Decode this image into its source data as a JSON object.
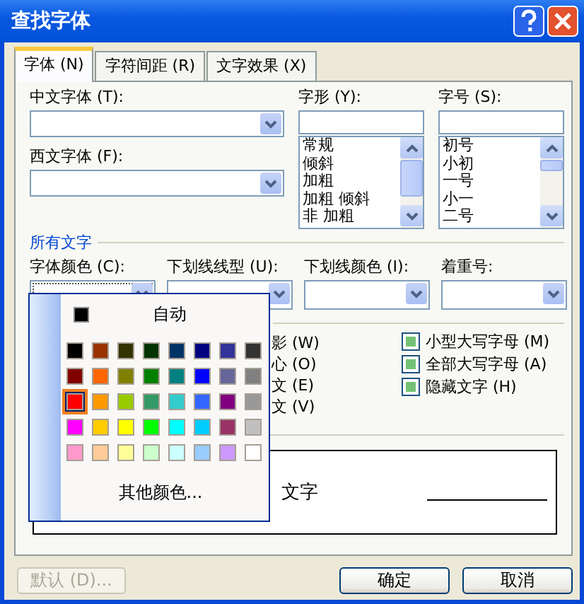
{
  "window": {
    "title": "查找字体"
  },
  "tabs": [
    {
      "label": "字体 (N)",
      "selected": true
    },
    {
      "label": "字符间距 (R)",
      "selected": false
    },
    {
      "label": "文字效果 (X)",
      "selected": false
    }
  ],
  "chinese_font": {
    "label": "中文字体 (T):"
  },
  "western_font": {
    "label": "西文字体 (F):"
  },
  "style": {
    "label": "字形 (Y):",
    "items": [
      "常规",
      "倾斜",
      "加粗",
      "加粗 倾斜",
      "非 加粗"
    ]
  },
  "size": {
    "label": "字号 (S):",
    "items": [
      "初号",
      "小初",
      "一号",
      "小一",
      "二号"
    ]
  },
  "all_text": {
    "title": "所有文字",
    "combos": [
      {
        "label": "字体颜色 (C):",
        "focused": true
      },
      {
        "label": "下划线线型 (U):",
        "focused": false
      },
      {
        "label": "下划线颜色 (I):",
        "focused": false
      },
      {
        "label": "着重号:",
        "focused": false
      }
    ]
  },
  "effects": {
    "column_1": [
      {
        "label": "影 (W)"
      },
      {
        "label": "心 (O)"
      },
      {
        "label": "文 (E)"
      },
      {
        "label": "文 (V)"
      }
    ],
    "column_2": [
      {
        "label": "小型大写字母 (M)",
        "indeterminate": true
      },
      {
        "label": "全部大写字母 (A)",
        "indeterminate": true
      },
      {
        "label": "隐藏文字 (H)",
        "indeterminate": true
      }
    ]
  },
  "preview": {
    "text": "文字"
  },
  "color_popup": {
    "auto_label": "自动",
    "more_label": "其他颜色...",
    "swatches": [
      {
        "color": "#000000",
        "selected": false
      },
      {
        "color": "#993300",
        "selected": false
      },
      {
        "color": "#333300",
        "selected": false
      },
      {
        "color": "#003300",
        "selected": false
      },
      {
        "color": "#003366",
        "selected": false
      },
      {
        "color": "#000080",
        "selected": false
      },
      {
        "color": "#333399",
        "selected": false
      },
      {
        "color": "#333333",
        "selected": false
      },
      {
        "color": "#800000",
        "selected": false
      },
      {
        "color": "#ff6600",
        "selected": false
      },
      {
        "color": "#808000",
        "selected": false
      },
      {
        "color": "#008000",
        "selected": false
      },
      {
        "color": "#008080",
        "selected": false
      },
      {
        "color": "#0000ff",
        "selected": false
      },
      {
        "color": "#666699",
        "selected": false
      },
      {
        "color": "#808080",
        "selected": false
      },
      {
        "color": "#ff0000",
        "selected": true
      },
      {
        "color": "#ff9900",
        "selected": false
      },
      {
        "color": "#99cc00",
        "selected": false
      },
      {
        "color": "#339966",
        "selected": false
      },
      {
        "color": "#33cccc",
        "selected": false
      },
      {
        "color": "#3366ff",
        "selected": false
      },
      {
        "color": "#800080",
        "selected": false
      },
      {
        "color": "#999999",
        "selected": false
      },
      {
        "color": "#ff00ff",
        "selected": false
      },
      {
        "color": "#ffcc00",
        "selected": false
      },
      {
        "color": "#ffff00",
        "selected": false
      },
      {
        "color": "#00ff00",
        "selected": false
      },
      {
        "color": "#00ffff",
        "selected": false
      },
      {
        "color": "#00ccff",
        "selected": false
      },
      {
        "color": "#993366",
        "selected": false
      },
      {
        "color": "#c0c0c0",
        "selected": false
      },
      {
        "color": "#ff99cc",
        "selected": false
      },
      {
        "color": "#ffcc99",
        "selected": false
      },
      {
        "color": "#ffff99",
        "selected": false
      },
      {
        "color": "#ccffcc",
        "selected": false
      },
      {
        "color": "#ccffff",
        "selected": false
      },
      {
        "color": "#99ccff",
        "selected": false
      },
      {
        "color": "#cc99ff",
        "selected": false
      },
      {
        "color": "#ffffff",
        "selected": false
      }
    ]
  },
  "buttons": [
    {
      "label": "默认 (D)...",
      "disabled": true
    },
    {
      "label": "确定",
      "disabled": false
    },
    {
      "label": "取消",
      "disabled": false
    }
  ]
}
